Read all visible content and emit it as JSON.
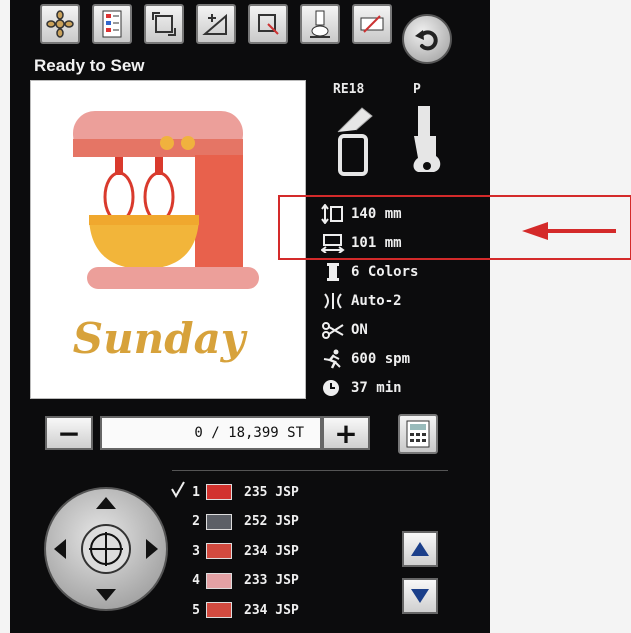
{
  "toolbar": {
    "icons": [
      "embroidery-flower-icon",
      "color-sort-icon",
      "rotate-frame-icon",
      "size-adjust-icon",
      "border-edit-icon",
      "presser-foot-icon",
      "needle-bar-icon"
    ],
    "back_icon": "return-arrow-icon"
  },
  "status": "Ready to Sew",
  "preview": {
    "design_text": "Sunday",
    "colors": {
      "pink": "#e9a3a3",
      "coral": "#e6684f",
      "red": "#d93c2f",
      "yellow": "#f2b53a",
      "gold": "#d7a23b"
    }
  },
  "machine": {
    "frame_label": "RE18",
    "foot_label": "P"
  },
  "info": {
    "height": "140 mm",
    "width": "101 mm",
    "colors": "6 Colors",
    "tension": "Auto-2",
    "thread_cut": "ON",
    "speed": "600 spm",
    "time": "37 min"
  },
  "stitch_counter": {
    "value": "0 / 18,399 ST",
    "minus": "−",
    "plus": "+"
  },
  "color_list": [
    {
      "index": "1",
      "code": "235 JSP",
      "color": "#d2322e",
      "checked": true
    },
    {
      "index": "2",
      "code": "252 JSP",
      "color": "#5c5f66",
      "checked": false
    },
    {
      "index": "3",
      "code": "234 JSP",
      "color": "#d24a3f",
      "checked": false
    },
    {
      "index": "4",
      "code": "233 JSP",
      "color": "#e3a1a4",
      "checked": false
    },
    {
      "index": "5",
      "code": "234 JSP",
      "color": "#d24a3f",
      "checked": false
    }
  ],
  "annotation_color": "#d42a2a"
}
